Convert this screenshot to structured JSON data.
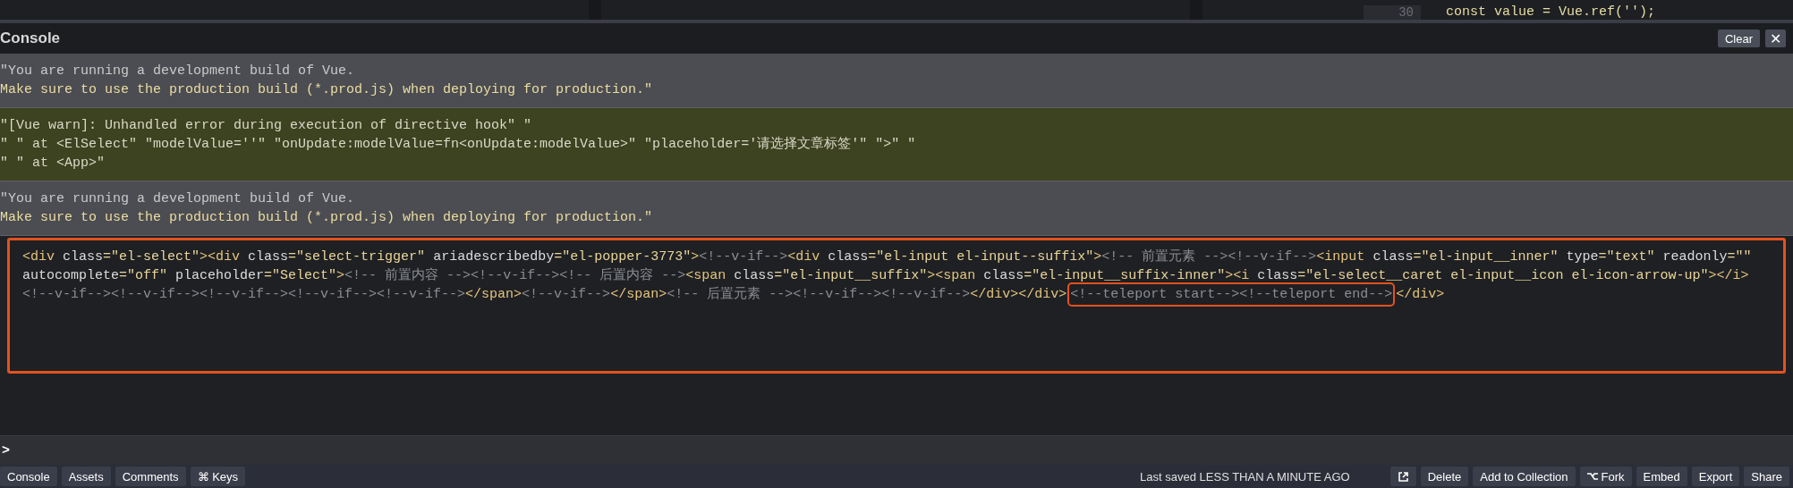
{
  "editor_strip": {
    "line_number": "30",
    "code": "const value = Vue.ref('');"
  },
  "console": {
    "title": "Console",
    "buttons": [
      {
        "kind": "text",
        "label": "Clear"
      },
      {
        "kind": "close",
        "label": "✕"
      }
    ],
    "messages": [
      {
        "kind": "log",
        "lines": [
          "\"You are running a development build of Vue.",
          "Make sure to use the production build (*.prod.js) when deploying for production.\""
        ]
      },
      {
        "kind": "warn",
        "lines": [
          "\"[Vue warn]: Unhandled error during execution of directive hook\" \"",
          "\" \" at <ElSelect\" \"modelValue=''\" \"onUpdate:modelValue=fn<onUpdate:modelValue>\" \"placeholder='请选择文章标签'\" \">\" \"",
          "\" \" at <App>\""
        ]
      },
      {
        "kind": "log",
        "lines": [
          "\"You are running a development build of Vue.",
          "Make sure to use the production build (*.prod.js) when deploying for production.\""
        ]
      }
    ],
    "code_block": {
      "highlighted": true,
      "lines": [
        [
          {
            "kind": "tag",
            "t": "<div"
          },
          {
            "kind": "attr",
            "t": " class"
          },
          {
            "kind": "str",
            "t": "=\"el-select\""
          },
          {
            "kind": "tag",
            "t": "><div"
          },
          {
            "kind": "attr",
            "t": " class"
          },
          {
            "kind": "str",
            "t": "=\"select-trigger\""
          },
          {
            "kind": "attr",
            "t": " ariadescribedby"
          },
          {
            "kind": "str",
            "t": "=\"el-popper-3773\""
          },
          {
            "kind": "tag",
            "t": ">"
          },
          {
            "kind": "comment",
            "t": "<!--v-if-->"
          },
          {
            "kind": "tag",
            "t": "<div"
          },
          {
            "kind": "attr",
            "t": " class"
          },
          {
            "kind": "str",
            "t": "=\"el-input el-input--suffix\""
          },
          {
            "kind": "tag",
            "t": ">"
          },
          {
            "kind": "comment",
            "t": "<!-- 前置元素 --><!--v-if-->"
          },
          {
            "kind": "tag",
            "t": "<input"
          },
          {
            "kind": "attr",
            "t": " class"
          },
          {
            "kind": "str",
            "t": "=\"el-input__inner\""
          },
          {
            "kind": "attr",
            "t": " type"
          },
          {
            "kind": "str",
            "t": "=\"text\""
          },
          {
            "kind": "attr",
            "t": " readonly"
          },
          {
            "kind": "str",
            "t": "=\"\""
          }
        ],
        [
          {
            "kind": "attr",
            "t": "autocomplete"
          },
          {
            "kind": "str",
            "t": "=\"off\""
          },
          {
            "kind": "attr",
            "t": " placeholder"
          },
          {
            "kind": "str",
            "t": "=\"Select\""
          },
          {
            "kind": "tag",
            "t": ">"
          },
          {
            "kind": "comment",
            "t": "<!-- 前置内容 --><!--v-if--><!-- 后置内容 -->"
          },
          {
            "kind": "tag",
            "t": "<span"
          },
          {
            "kind": "attr",
            "t": " class"
          },
          {
            "kind": "str",
            "t": "=\"el-input__suffix\""
          },
          {
            "kind": "tag",
            "t": "><span"
          },
          {
            "kind": "attr",
            "t": " class"
          },
          {
            "kind": "str",
            "t": "=\"el-input__suffix-inner\""
          },
          {
            "kind": "tag",
            "t": "><i"
          },
          {
            "kind": "attr",
            "t": " class"
          },
          {
            "kind": "str",
            "t": "=\"el-select__caret el-input__icon el-icon-arrow-up\""
          },
          {
            "kind": "tag",
            "t": "></i>"
          }
        ],
        [
          {
            "kind": "comment",
            "t": "<!--v-if--><!--v-if--><!--v-if--><!--v-if--><!--v-if-->"
          },
          {
            "kind": "tag",
            "t": "</span>"
          },
          {
            "kind": "comment",
            "t": "<!--v-if-->"
          },
          {
            "kind": "tag",
            "t": "</span>"
          },
          {
            "kind": "comment",
            "t": "<!-- 后置元素 --><!--v-if--><!--v-if-->"
          },
          {
            "kind": "tag",
            "t": "</div></div>"
          },
          {
            "kind": "comment",
            "t": "<!--teleport start--><!--teleport end-->",
            "highlighted": true
          },
          {
            "kind": "tag",
            "t": "</div>"
          }
        ]
      ]
    },
    "prompt": ">"
  },
  "footer": {
    "tabs": [
      "Console",
      "Assets",
      "Comments",
      "⌘ Keys"
    ],
    "status": "Last saved LESS THAN A MINUTE AGO",
    "actions": [
      {
        "kind": "icon"
      },
      {
        "kind": "text",
        "label": "Delete"
      },
      {
        "kind": "text",
        "label": "Add to Collection"
      },
      {
        "kind": "fork",
        "label": "Fork"
      },
      {
        "kind": "text",
        "label": "Embed"
      },
      {
        "kind": "text",
        "label": "Export"
      },
      {
        "kind": "text",
        "label": "Share"
      }
    ]
  }
}
